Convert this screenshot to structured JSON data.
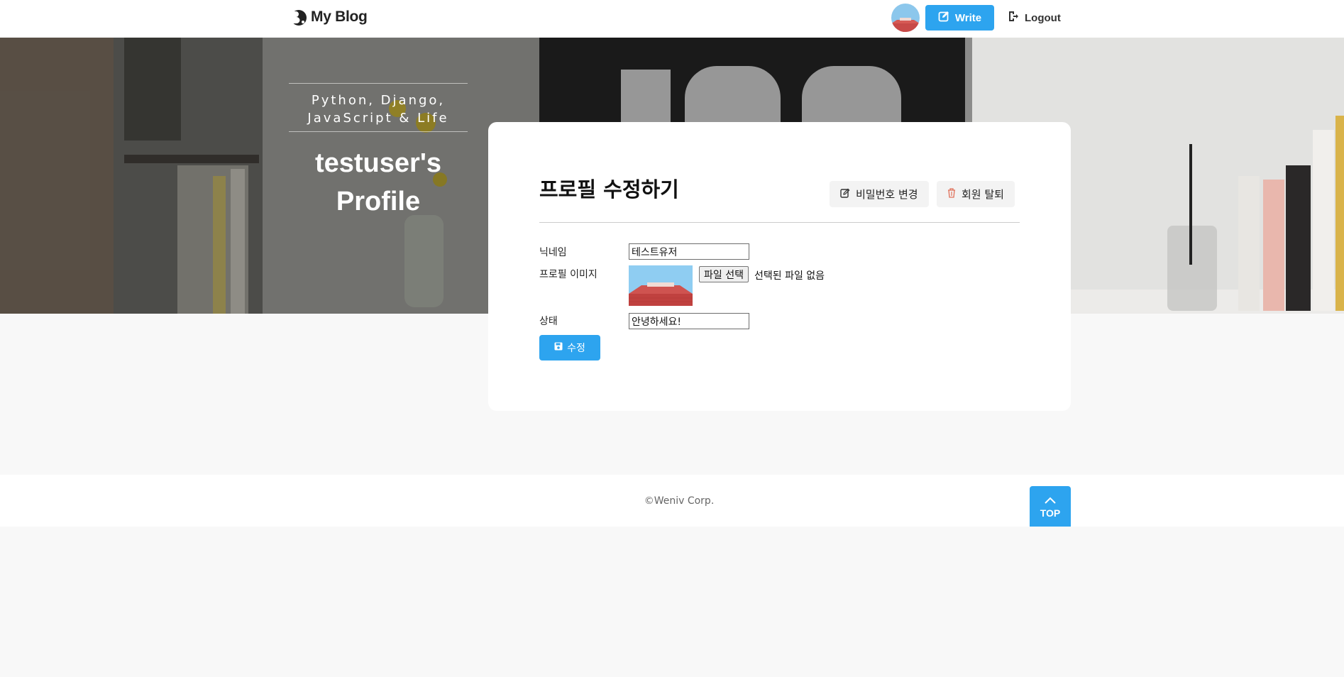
{
  "header": {
    "logo_text": "My Blog",
    "write_label": "Write",
    "logout_label": "Logout"
  },
  "hero": {
    "subtitle": "Python, Django, JavaScript & Life",
    "profile_title": "testuser's Profile"
  },
  "card": {
    "title": "프로필 수정하기",
    "change_password_label": "비밀번호 변경",
    "withdraw_label": "회원 탈퇴",
    "form": {
      "nickname_label": "닉네임",
      "nickname_value": "테스트유저",
      "image_label": "프로필 이미지",
      "file_button_label": "파일 선택",
      "file_status": "선택된 파일 없음",
      "status_label": "상태",
      "status_value": "안녕하세요!",
      "submit_label": "수정"
    }
  },
  "footer": {
    "copyright": "©Weniv Corp.",
    "top_label": "TOP"
  },
  "colors": {
    "accent": "#2da4ef",
    "page_background": "#f8f8f8",
    "card_background": "#ffffff"
  },
  "icons": [
    "logo-icon",
    "avatar-image",
    "edit-icon",
    "logout-icon",
    "edit-icon",
    "trash-icon",
    "save-icon",
    "chevron-up-icon"
  ]
}
